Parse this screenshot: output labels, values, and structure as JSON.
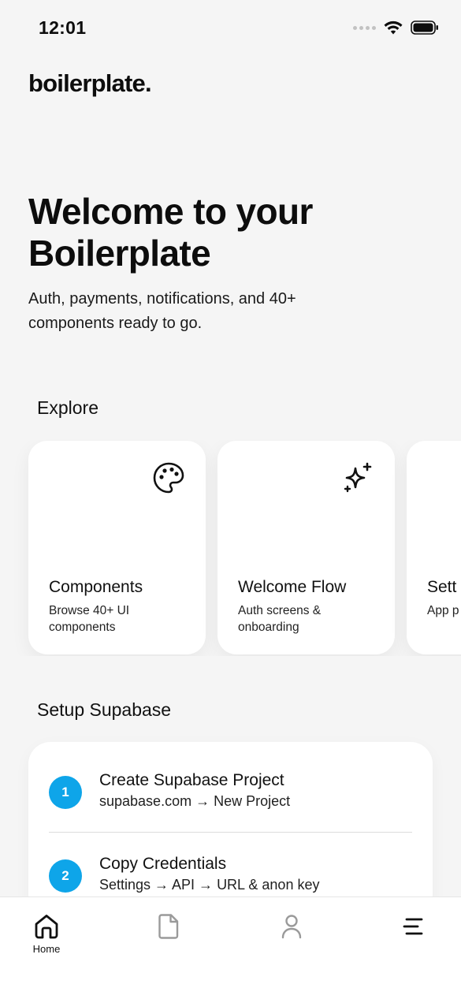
{
  "status_bar": {
    "time": "12:01"
  },
  "app": {
    "logo": "boilerplate."
  },
  "hero": {
    "title": "Welcome to your Boilerplate",
    "subtitle": "Auth, payments, notifications, and 40+ components ready to go."
  },
  "explore": {
    "title": "Explore",
    "cards": [
      {
        "title": "Components",
        "description": "Browse 40+ UI components",
        "icon": "palette-icon"
      },
      {
        "title": "Welcome Flow",
        "description": "Auth screens & onboarding",
        "icon": "sparkles-icon"
      },
      {
        "title": "Sett",
        "description": "App p",
        "icon": ""
      }
    ]
  },
  "setup": {
    "title": "Setup Supabase",
    "steps": [
      {
        "number": "1",
        "title": "Create Supabase Project",
        "subtitle": "supabase.com → New Project"
      },
      {
        "number": "2",
        "title": "Copy Credentials",
        "subtitle": "Settings → API → URL & anon key"
      }
    ]
  },
  "tab_bar": {
    "tabs": [
      {
        "label": "Home",
        "icon": "home-icon",
        "active": true
      },
      {
        "label": "",
        "icon": "document-icon",
        "active": false
      },
      {
        "label": "",
        "icon": "user-icon",
        "active": false
      },
      {
        "label": "",
        "icon": "menu-icon",
        "active": false
      }
    ]
  },
  "colors": {
    "accent": "#0ea5e9",
    "background": "#f5f5f5",
    "card": "#ffffff",
    "inactive_icon": "#9a9a9a"
  }
}
